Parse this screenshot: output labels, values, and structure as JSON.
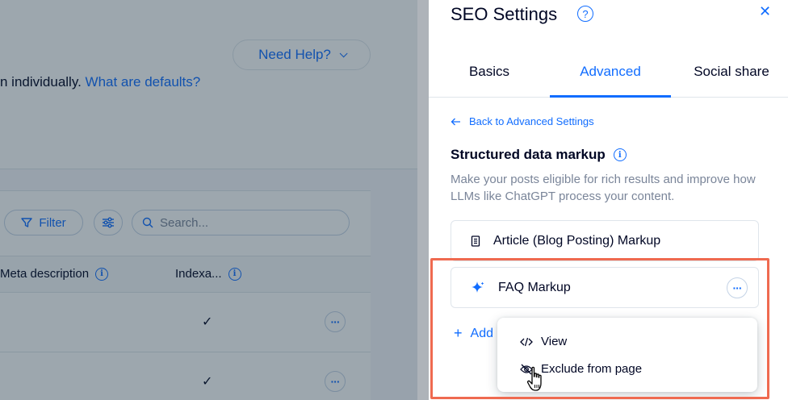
{
  "background": {
    "need_help_label": "Need Help?",
    "intro_text": "n individually.",
    "intro_link": "What are defaults?",
    "filter_label": "Filter",
    "search_placeholder": "Search...",
    "columns": [
      "Meta description",
      "Indexa..."
    ],
    "rows": [
      {
        "indexable_mark": "✓"
      },
      {
        "indexable_mark": "✓"
      }
    ]
  },
  "panel": {
    "title": "SEO Settings",
    "tabs": [
      {
        "label": "Basics",
        "active": false
      },
      {
        "label": "Advanced",
        "active": true
      },
      {
        "label": "Social share",
        "active": false
      }
    ],
    "back_link": "Back to Advanced Settings",
    "section_title": "Structured data markup",
    "section_description": "Make your posts eligible for rich results and improve how LLMs like ChatGPT process your content.",
    "markups": [
      {
        "label": "Article (Blog Posting) Markup",
        "icon": "document-icon"
      },
      {
        "label": "FAQ Markup",
        "icon": "sparkle-icon"
      }
    ],
    "add_label": "Add",
    "context_menu": [
      {
        "label": "View",
        "icon": "code-icon"
      },
      {
        "label": "Exclude from page",
        "icon": "eye-off-icon"
      }
    ]
  },
  "colors": {
    "accent": "#116dff",
    "highlight": "#ef6a50",
    "text": "#000624",
    "muted": "#7a8599"
  }
}
